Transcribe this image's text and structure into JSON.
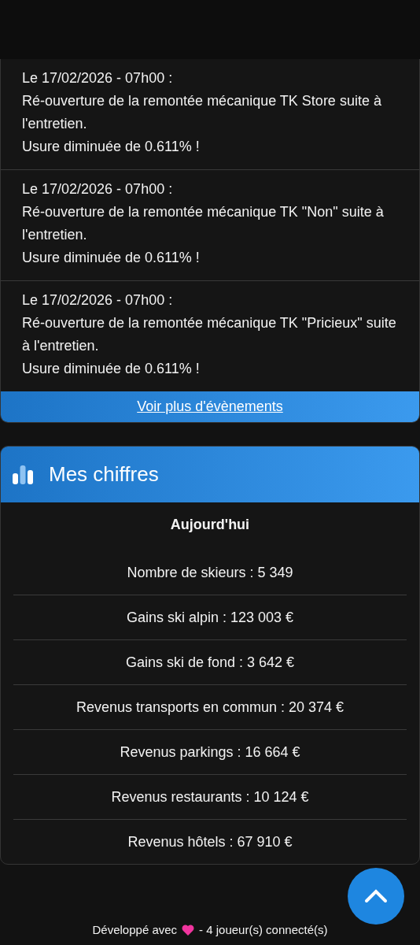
{
  "events": [
    {
      "date": "Le 17/02/2026 - 07h00 :",
      "message": "Ré-ouverture de la remontée mécanique TK Store suite à l'entretien.",
      "detail": "Usure diminuée de 0.611% !"
    },
    {
      "date": "Le 17/02/2026 - 07h00 :",
      "message": "Ré-ouverture de la remontée mécanique TK \"Non\" suite à l'entretien.",
      "detail": "Usure diminuée de 0.611% !"
    },
    {
      "date": "Le 17/02/2026 - 07h00 :",
      "message": "Ré-ouverture de la remontée mécanique TK \"Pricieux\" suite à l'entretien.",
      "detail": "Usure diminuée de 0.611% !"
    }
  ],
  "more_link": "Voir plus d'évènements",
  "stats": {
    "title": "Mes chiffres",
    "period": "Aujourd'hui",
    "rows": [
      "Nombre de skieurs : 5 349",
      "Gains ski alpin : 123 003 €",
      "Gains ski de fond : 3 642 €",
      "Revenus transports en commun : 20 374 €",
      "Revenus parkings : 16 664 €",
      "Revenus restaurants : 10 124 €",
      "Revenus hôtels : 67 910 €"
    ]
  },
  "footer": {
    "before": "Développé avec",
    "after": "- 4 joueur(s) connecté(s)"
  }
}
